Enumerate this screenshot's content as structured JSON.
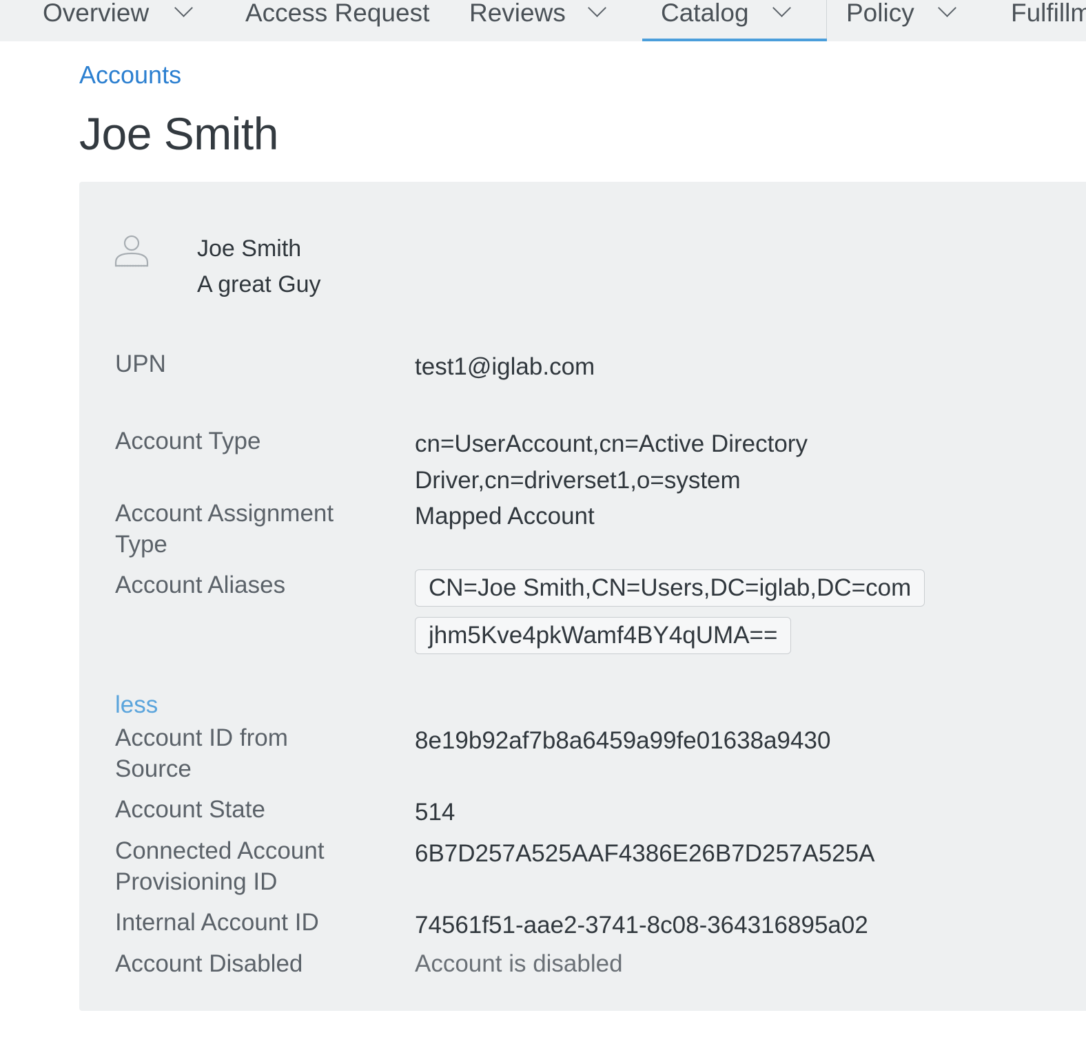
{
  "nav": {
    "items": [
      {
        "label": "Overview"
      },
      {
        "label": "Access Request"
      },
      {
        "label": "Reviews"
      },
      {
        "label": "Catalog"
      },
      {
        "label": "Policy"
      },
      {
        "label": "Fulfillm"
      }
    ],
    "active": "Catalog",
    "accent_color": "#4a9edb"
  },
  "breadcrumb": {
    "label": "Accounts"
  },
  "page": {
    "title": "Joe Smith"
  },
  "identity": {
    "icon": "user-icon",
    "name": "Joe Smith",
    "description": "A great Guy"
  },
  "details": {
    "upn": {
      "label": "UPN",
      "value": "test1@iglab.com"
    },
    "account_type": {
      "label": "Account Type",
      "value_line1": "cn=UserAccount,cn=Active Directory",
      "value_line2": "Driver,cn=driverset1,o=system"
    },
    "assignment_type": {
      "label_line1": "Account Assignment",
      "label_line2": "Type",
      "value": "Mapped Account"
    },
    "aliases": {
      "label": "Account Aliases",
      "values": [
        "CN=Joe Smith,CN=Users,DC=iglab,DC=com",
        "jhm5Kve4pkWamf4BY4qUMA=="
      ]
    },
    "toggle_label": "less",
    "account_id": {
      "label_line1": "Account ID from",
      "label_line2": "Source",
      "value": "8e19b92af7b8a6459a99fe01638a9430"
    },
    "account_state": {
      "label": "Account State",
      "value": "514"
    },
    "provisioning_id": {
      "label_line1": "Connected Account",
      "label_line2": "Provisioning ID",
      "value": "6B7D257A525AAF4386E26B7D257A525A"
    },
    "internal_id": {
      "label": "Internal Account ID",
      "value": "74561f51-aae2-3741-8c08-364316895a02"
    },
    "disabled": {
      "label": "Account Disabled",
      "value": "Account is disabled"
    }
  }
}
